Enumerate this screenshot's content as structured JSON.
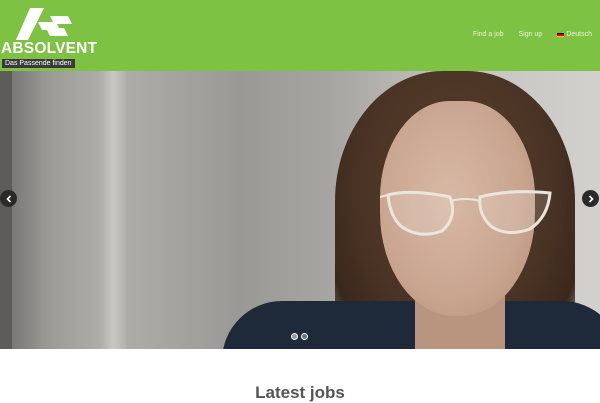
{
  "header": {
    "bg_color": "#7dc243",
    "logo": {
      "wordmark": "ABSOLVENT",
      "tagline": "Das Passende finden"
    },
    "nav": {
      "items": [
        {
          "label": "Find a job"
        },
        {
          "label": "Sign up"
        }
      ],
      "language": {
        "label": "Deutsch",
        "icon": "german-flag-icon"
      }
    }
  },
  "slider": {
    "prev_icon": "chevron-left-icon",
    "next_icon": "chevron-right-icon",
    "slide_count": 2,
    "active_slide": 1
  },
  "main": {
    "section_title": "Latest jobs"
  }
}
